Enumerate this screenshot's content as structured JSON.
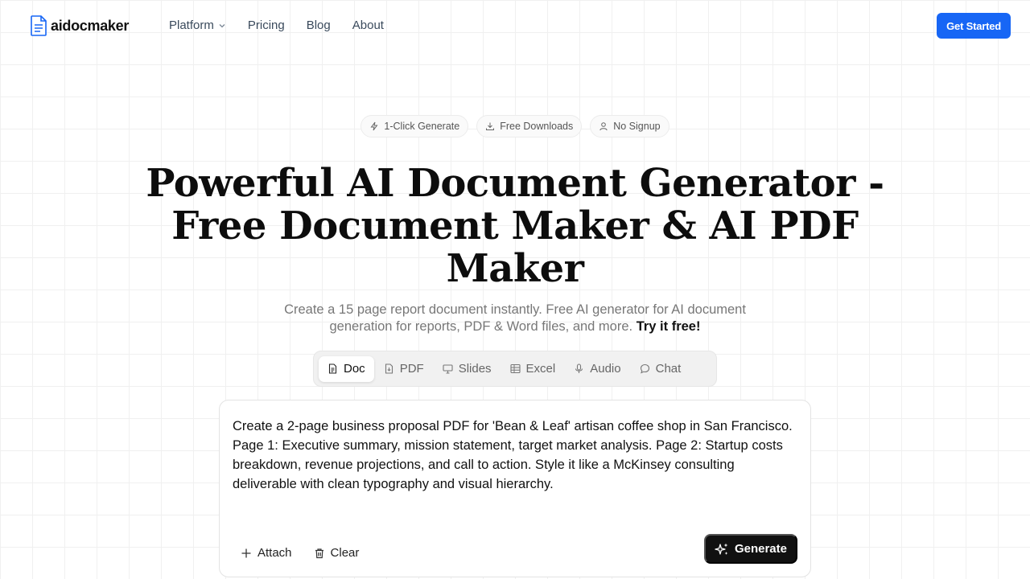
{
  "header": {
    "logo_text": "aidocmaker",
    "nav": [
      {
        "label": "Platform"
      },
      {
        "label": "Pricing"
      },
      {
        "label": "Blog"
      },
      {
        "label": "About"
      }
    ],
    "cta_label": "Get Started"
  },
  "badges": [
    {
      "label": "1-Click Generate",
      "icon": "lightning-icon"
    },
    {
      "label": "Free Downloads",
      "icon": "download-icon"
    },
    {
      "label": "No Signup",
      "icon": "user-icon"
    }
  ],
  "hero": {
    "title_lines": [
      "Powerful AI Document Generator -",
      "Free Document Maker & AI PDF",
      "Maker"
    ],
    "subtitle": "Create a 15 page report document instantly. Free AI generator for AI document generation for reports, PDF & Word files, and more.",
    "subtitle_cta": "Try it free!"
  },
  "tabs": [
    {
      "label": "Doc",
      "icon": "document-icon",
      "active": true
    },
    {
      "label": "PDF",
      "icon": "pdf-icon",
      "active": false
    },
    {
      "label": "Slides",
      "icon": "presentation-icon",
      "active": false
    },
    {
      "label": "Excel",
      "icon": "table-icon",
      "active": false
    },
    {
      "label": "Audio",
      "icon": "microphone-icon",
      "active": false
    },
    {
      "label": "Chat",
      "icon": "chat-bubble-icon",
      "active": false
    }
  ],
  "prompt": {
    "value": "Create a 2-page business proposal PDF for 'Bean & Leaf' artisan coffee shop in San Francisco. Page 1: Executive summary, mission statement, target market analysis. Page 2: Startup costs breakdown, revenue projections, and call to action. Style it like a McKinsey consulting deliverable with clean typography and visual hierarchy.",
    "attach_label": "Attach",
    "clear_label": "Clear",
    "generate_label": "Generate"
  },
  "colors": {
    "accent": "#1766f5",
    "generate_bg": "#111111",
    "text_muted": "#777777"
  }
}
